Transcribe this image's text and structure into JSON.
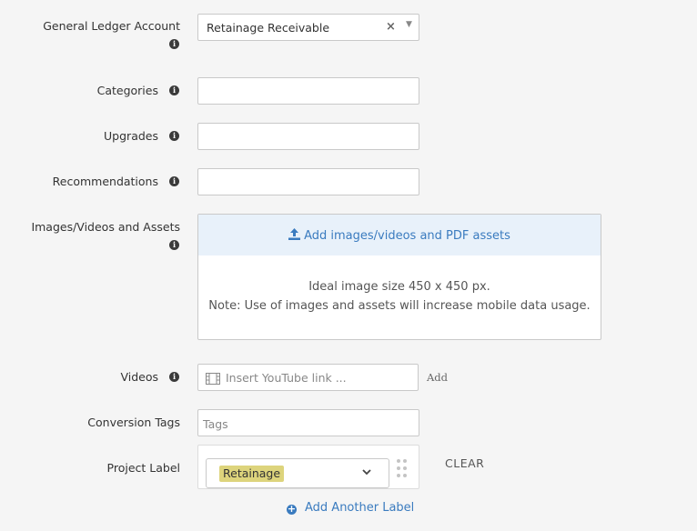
{
  "form": {
    "gl_account": {
      "label": "General Ledger Account",
      "value": "Retainage Receivable",
      "clear_glyph": "×",
      "arrow_glyph": "▼"
    },
    "categories": {
      "label": "Categories",
      "value": ""
    },
    "upgrades": {
      "label": "Upgrades",
      "value": ""
    },
    "recommendations": {
      "label": "Recommendations",
      "value": ""
    },
    "media": {
      "label": "Images/Videos and Assets",
      "upload_link": "Add images/videos and PDF assets",
      "note_line1": "Ideal image size 450 x 450 px.",
      "note_line2": "Note: Use of images and assets will increase mobile data usage."
    },
    "videos": {
      "label": "Videos",
      "placeholder": "Insert YouTube link ...",
      "add_button": "Add"
    },
    "conversion_tags": {
      "label": "Conversion Tags",
      "placeholder": "Tags"
    },
    "project_label": {
      "label": "Project Label",
      "selected": "Retainage",
      "clear_button": "CLEAR",
      "add_another": "Add Another Label"
    }
  },
  "colors": {
    "link": "#3a7bbf",
    "tag_bg": "#ddd47c",
    "upload_header_bg": "#e8f1fa",
    "page_bg": "#f5f5f5"
  },
  "icons": {
    "info": "info-circle-icon",
    "upload": "upload-icon",
    "film": "film-icon",
    "chevron": "chevron-down-icon",
    "drag": "drag-handle-icon",
    "plus": "plus-circle-icon"
  }
}
